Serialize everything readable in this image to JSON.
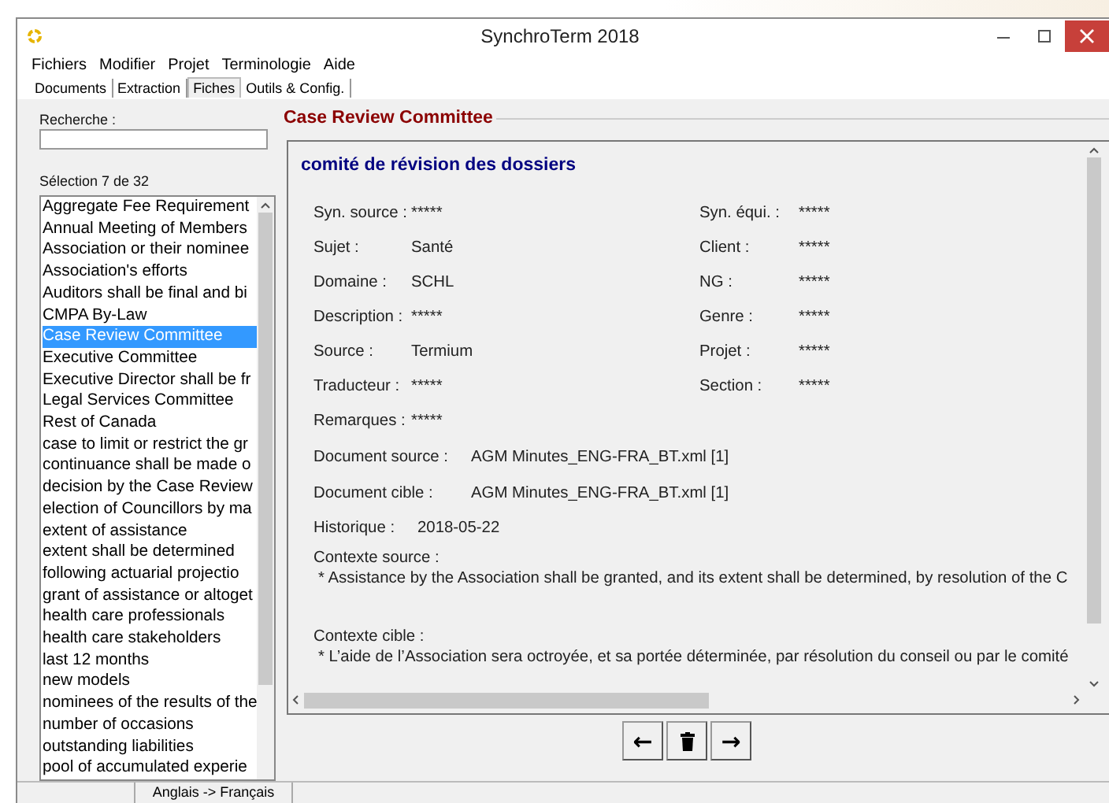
{
  "window": {
    "title": "SynchroTerm 2018"
  },
  "menu": [
    "Fichiers",
    "Modifier",
    "Projet",
    "Terminologie",
    "Aide"
  ],
  "tabs": [
    {
      "label": "Documents",
      "selected": false
    },
    {
      "label": "Extraction",
      "selected": false
    },
    {
      "label": "Fiches",
      "selected": true
    },
    {
      "label": "Outils & Config.",
      "selected": false
    }
  ],
  "search": {
    "label": "Recherche :"
  },
  "selection_count": "Sélection 7 de 32",
  "terms": [
    {
      "label": "Aggregate Fee Requirement",
      "selected": false
    },
    {
      "label": "Annual Meeting of Members",
      "selected": false
    },
    {
      "label": "Association or their nominee",
      "selected": false
    },
    {
      "label": "Association's efforts",
      "selected": false
    },
    {
      "label": "Auditors shall be final and bi",
      "selected": false
    },
    {
      "label": "CMPA By-Law",
      "selected": false
    },
    {
      "label": "Case Review Committee",
      "selected": true
    },
    {
      "label": "Executive Committee",
      "selected": false
    },
    {
      "label": "Executive Director shall be fr",
      "selected": false
    },
    {
      "label": "Legal Services Committee",
      "selected": false
    },
    {
      "label": "Rest of Canada",
      "selected": false
    },
    {
      "label": "case to limit or restrict the gr",
      "selected": false
    },
    {
      "label": "continuance shall be made o",
      "selected": false
    },
    {
      "label": "decision by the Case Review",
      "selected": false
    },
    {
      "label": "election of Councillors by ma",
      "selected": false
    },
    {
      "label": "extent of assistance",
      "selected": false
    },
    {
      "label": "extent shall be determined",
      "selected": false
    },
    {
      "label": "following actuarial projectio",
      "selected": false
    },
    {
      "label": "grant of assistance or altoget",
      "selected": false
    },
    {
      "label": "health care professionals",
      "selected": false
    },
    {
      "label": "health care stakeholders",
      "selected": false
    },
    {
      "label": "last 12 months",
      "selected": false
    },
    {
      "label": "new models",
      "selected": false
    },
    {
      "label": "nominees of the results of the",
      "selected": false
    },
    {
      "label": "number of occasions",
      "selected": false
    },
    {
      "label": "outstanding liabilities",
      "selected": false
    },
    {
      "label": "pool of accumulated experie",
      "selected": false
    }
  ],
  "record": {
    "heading": "Case Review Committee",
    "translation": "comité de révision des dossiers",
    "fields": [
      {
        "label": "Syn. source :",
        "value": "*****"
      },
      {
        "label": "Syn. équi. :",
        "value": "*****"
      },
      {
        "label": "Sujet :",
        "value": "Santé"
      },
      {
        "label": "Client :",
        "value": "*****"
      },
      {
        "label": "Domaine :",
        "value": "SCHL"
      },
      {
        "label": "NG :",
        "value": "*****"
      },
      {
        "label": "Description :",
        "value": "*****"
      },
      {
        "label": "Genre :",
        "value": "*****"
      },
      {
        "label": "Source :",
        "value": "Termium"
      },
      {
        "label": "Projet :",
        "value": "*****"
      },
      {
        "label": "Traducteur :",
        "value": "*****"
      },
      {
        "label": "Section :",
        "value": "*****"
      }
    ],
    "remarks": {
      "label": "Remarques :",
      "value": "*****"
    },
    "documents": [
      {
        "label": "Document source :",
        "value": "AGM Minutes_ENG-FRA_BT.xml [1]"
      },
      {
        "label": "Document cible :",
        "value": "AGM Minutes_ENG-FRA_BT.xml [1]"
      }
    ],
    "history": {
      "label": "Historique :",
      "value": "2018-05-22"
    },
    "contexts": [
      {
        "label": "Contexte source :",
        "text": "* Assistance by the Association shall be granted, and its extent shall be determined, by resolution of the C"
      },
      {
        "label": "Contexte cible :",
        "text": "* L’aide de l’Association sera octroyée, et sa portée déterminée, par résolution du conseil ou par le comité"
      }
    ]
  },
  "nav_buttons": [
    {
      "kind": "text",
      "label": "←"
    },
    {
      "kind": "delete"
    },
    {
      "kind": "text",
      "label": "→"
    }
  ],
  "status_bar": {
    "language_pair": "Anglais -> Français"
  }
}
